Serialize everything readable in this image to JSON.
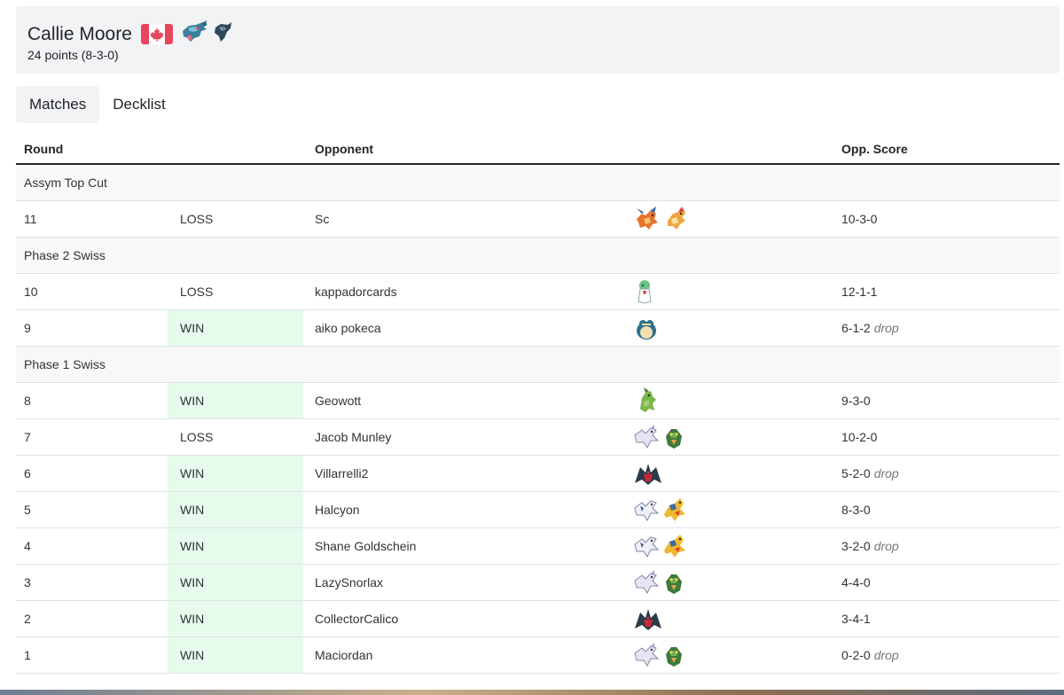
{
  "player": {
    "name": "Callie Moore",
    "flag": "canada-flag-icon",
    "record": "24 points (8-3-0)",
    "deck_icons": [
      "dragapult-sprite-icon",
      "dreepy-sprite-icon"
    ]
  },
  "tabs": [
    {
      "label": "Matches",
      "active": true
    },
    {
      "label": "Decklist",
      "active": false
    }
  ],
  "table": {
    "headers": {
      "round": "Round",
      "result": "",
      "opponent": "Opponent",
      "deck": "",
      "score": "Opp. Score"
    },
    "rows": [
      {
        "type": "section",
        "label": "Assym Top Cut"
      },
      {
        "type": "match",
        "round": "11",
        "result": "LOSS",
        "opponent": "Sc",
        "deck": [
          "charizard",
          "pidgeot"
        ],
        "score": "10-3-0",
        "drop": ""
      },
      {
        "type": "section",
        "label": "Phase 2 Swiss"
      },
      {
        "type": "match",
        "round": "10",
        "result": "LOSS",
        "opponent": "kappadorcards",
        "deck": [
          "gardevoir"
        ],
        "score": "12-1-1",
        "drop": ""
      },
      {
        "type": "match",
        "round": "9",
        "result": "WIN",
        "opponent": "aiko pokeca",
        "deck": [
          "snorlax"
        ],
        "score": "6-1-2",
        "drop": "drop"
      },
      {
        "type": "section",
        "label": "Phase 1 Swiss"
      },
      {
        "type": "match",
        "round": "8",
        "result": "WIN",
        "opponent": "Geowott",
        "deck": [
          "tyranitar"
        ],
        "score": "9-3-0",
        "drop": ""
      },
      {
        "type": "match",
        "round": "7",
        "result": "LOSS",
        "opponent": "Jacob Munley",
        "deck": [
          "lugia-white",
          "decidueye"
        ],
        "score": "10-2-0",
        "drop": ""
      },
      {
        "type": "match",
        "round": "6",
        "result": "WIN",
        "opponent": "Villarrelli2",
        "deck": [
          "yveltal"
        ],
        "score": "5-2-0",
        "drop": "drop"
      },
      {
        "type": "match",
        "round": "5",
        "result": "WIN",
        "opponent": "Halcyon",
        "deck": [
          "lugia",
          "archeops"
        ],
        "score": "8-3-0",
        "drop": ""
      },
      {
        "type": "match",
        "round": "4",
        "result": "WIN",
        "opponent": "Shane Goldschein",
        "deck": [
          "lugia",
          "archeops"
        ],
        "score": "3-2-0",
        "drop": "drop"
      },
      {
        "type": "match",
        "round": "3",
        "result": "WIN",
        "opponent": "LazySnorlax",
        "deck": [
          "lugia-white",
          "decidueye"
        ],
        "score": "4-4-0",
        "drop": ""
      },
      {
        "type": "match",
        "round": "2",
        "result": "WIN",
        "opponent": "CollectorCalico",
        "deck": [
          "yveltal"
        ],
        "score": "3-4-1",
        "drop": ""
      },
      {
        "type": "match",
        "round": "1",
        "result": "WIN",
        "opponent": "Maciordan",
        "deck": [
          "lugia-white",
          "decidueye"
        ],
        "score": "0-2-0",
        "drop": "drop"
      }
    ]
  },
  "colors": {
    "win_bg": "#e6fbec",
    "card_bg": "#f2f3f5",
    "section_bg": "#f8f8f9"
  }
}
